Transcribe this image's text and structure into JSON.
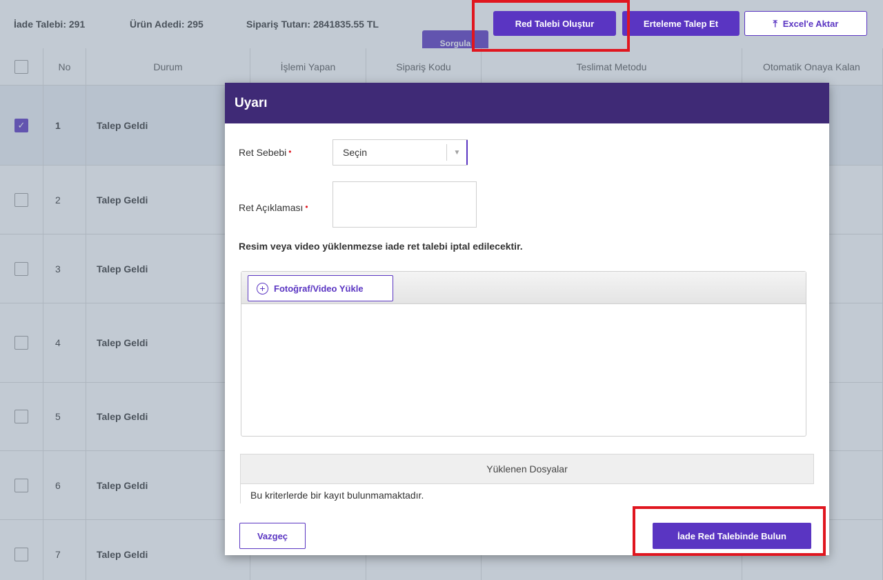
{
  "summary": {
    "iade_talebi": "İade Talebi: 291",
    "urun_adedi": "Ürün Adedi: 295",
    "siparis_tutari": "Sipariş Tutarı: 2841835.55 TL"
  },
  "toolbar": {
    "red_talebi_label": "Red Talebi Oluştur",
    "erteleme_label": "Erteleme Talep Et",
    "excel_label": "Excel'e Aktar",
    "excel_icon": "upload-arrow-icon",
    "partial_button_label": "Sorgula"
  },
  "table": {
    "headers": [
      "No",
      "Durum",
      "İşlemi Yapan",
      "Sipariş Kodu",
      "Teslimat Metodu",
      "Otomatik Onaya Kalan"
    ],
    "rows": [
      {
        "no": "1",
        "durum": "Talep Geldi",
        "checked": true
      },
      {
        "no": "2",
        "durum": "Talep Geldi",
        "checked": false
      },
      {
        "no": "3",
        "durum": "Talep Geldi",
        "checked": false
      },
      {
        "no": "4",
        "durum": "Talep Geldi",
        "checked": false
      },
      {
        "no": "5",
        "durum": "Talep Geldi",
        "checked": false
      },
      {
        "no": "6",
        "durum": "Talep Geldi",
        "checked": false
      },
      {
        "no": "7",
        "durum": "Talep Geldi",
        "checked": false
      }
    ]
  },
  "modal": {
    "title": "Uyarı",
    "ret_sebebi_label": "Ret Sebebi",
    "ret_sebebi_value": "Seçin",
    "ret_aciklamasi_label": "Ret Açıklaması",
    "required_mark": "•",
    "notice": "Resim veya video yüklenmezse iade ret talebi iptal edilecektir.",
    "upload_label": "Fotoğraf/Video Yükle",
    "files_header": "Yüklenen Dosyalar",
    "files_empty": "Bu kriterlerde bir kayıt bulunmamaktadır.",
    "cancel_label": "Vazgeç",
    "submit_label": "İade Red Talebinde Bulun"
  },
  "colors": {
    "accent": "#5a35c2",
    "header": "#3f2a76",
    "highlight": "#e0161f"
  }
}
